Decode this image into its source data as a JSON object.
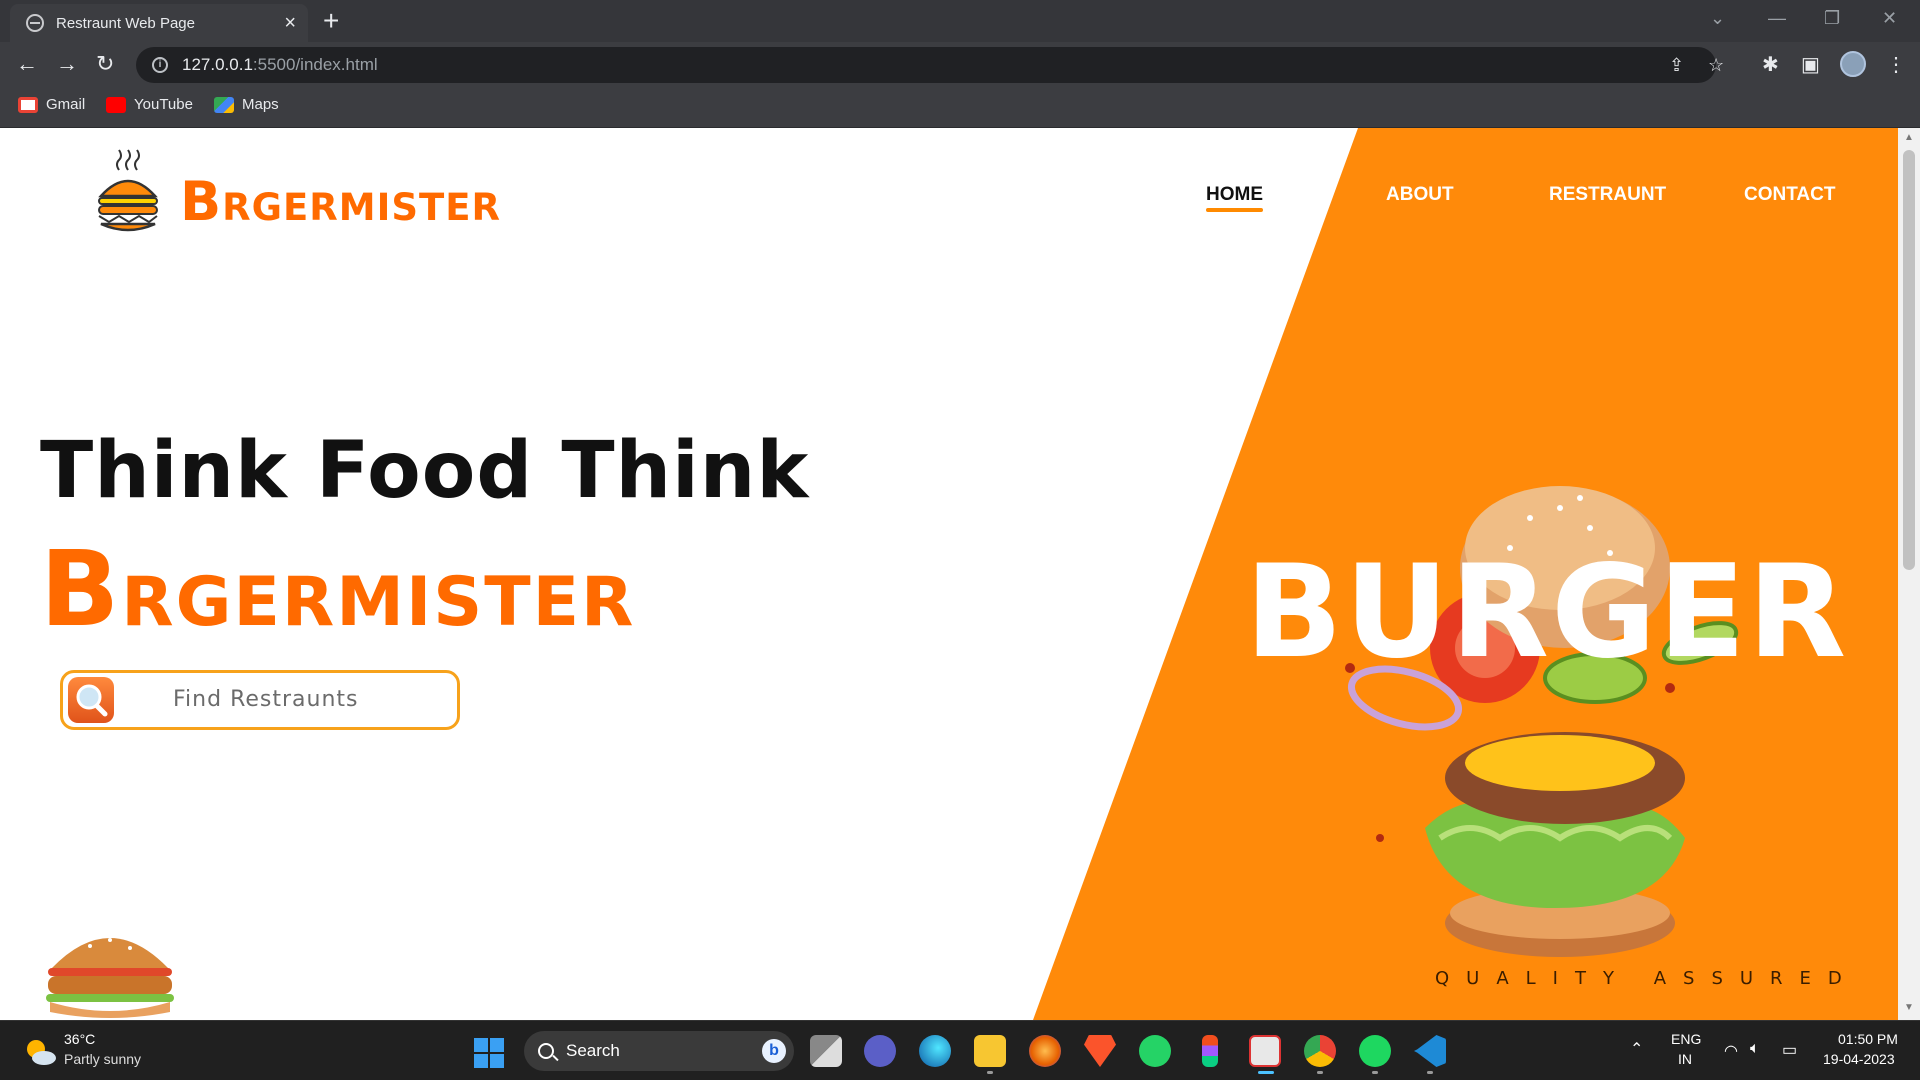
{
  "browser": {
    "tab_title": "Restraunt Web Page",
    "url_host": "127.0.0.1",
    "url_path": ":5500/index.html",
    "bookmarks": [
      "Gmail",
      "YouTube",
      "Maps"
    ]
  },
  "site": {
    "logo_cap": "B",
    "logo_rest": "RGERMISTER",
    "nav": [
      "HOME",
      "ABOUT",
      "RESTRAUNT",
      "CONTACT"
    ],
    "headline": "Think Food Think",
    "brand_cap": "B",
    "brand_rest": "RGERMISTER",
    "search_placeholder": "Find Restraunts",
    "hero_word": "BURGER",
    "tagline": "QUALITY ASSURED"
  },
  "taskbar": {
    "weather_temp": "36°C",
    "weather_desc": "Partly sunny",
    "search_label": "Search",
    "lang": "ENG",
    "region": "IN",
    "time": "01:50 PM",
    "date": "19-04-2023"
  },
  "colors": {
    "brand_orange": "#ff6a00",
    "hero_orange": "#ff8a0a",
    "chrome_dark": "#35363a"
  }
}
